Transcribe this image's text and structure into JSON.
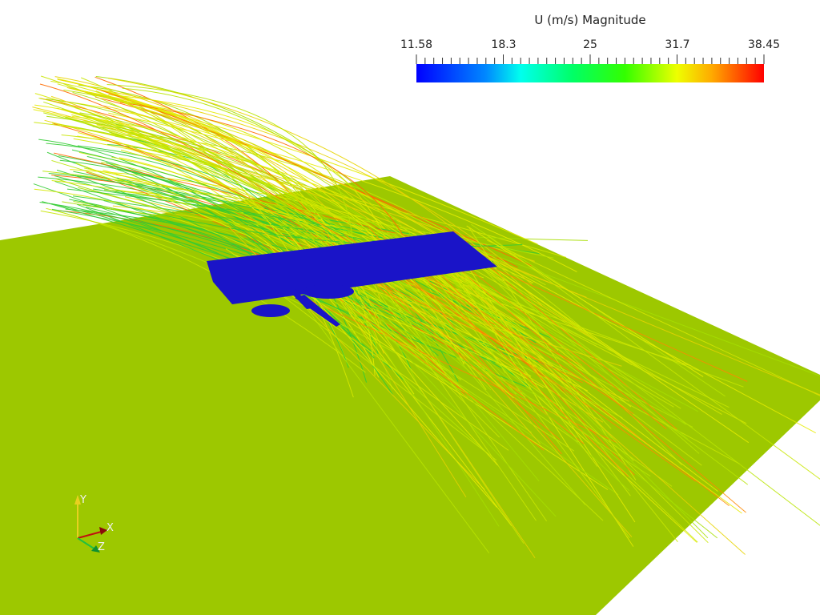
{
  "colorbar": {
    "title": "U (m/s) Magnitude",
    "min": 11.58,
    "max": 38.45,
    "tick_labels": [
      "11.58",
      "18.3",
      "25",
      "31.7",
      "38.45"
    ],
    "tick_values": [
      11.58,
      18.3,
      25,
      31.7,
      38.45
    ],
    "colormap": "rainbow-blue-to-red"
  },
  "colors": {
    "ground": "#9dc800",
    "aircraft": "#1a14c8",
    "background": "#ffffff"
  },
  "orientation_axes": {
    "x_label": "X",
    "y_label": "Y",
    "z_label": "Z"
  }
}
